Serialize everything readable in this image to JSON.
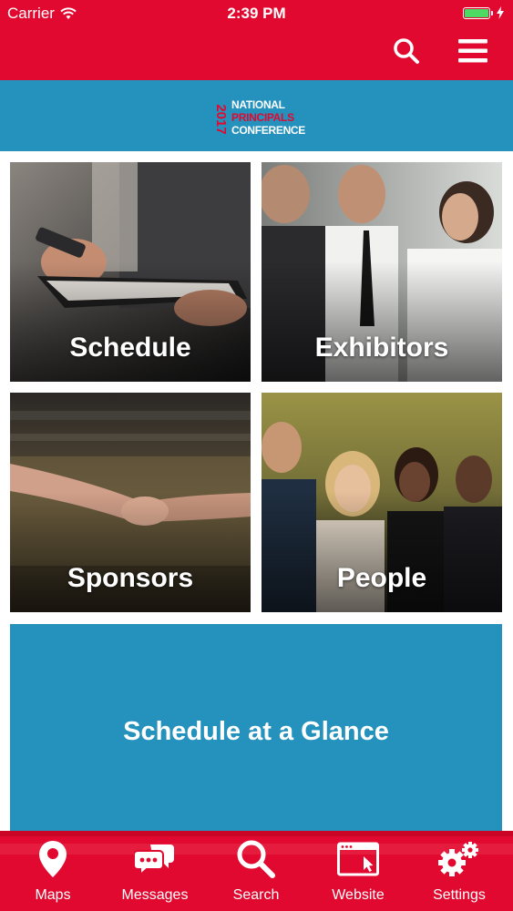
{
  "status_bar": {
    "carrier": "Carrier",
    "time": "2:39 PM"
  },
  "nav": {
    "search_icon": "search-icon",
    "menu_icon": "menu-icon"
  },
  "logo": {
    "year": "2017",
    "line1": "NATIONAL",
    "line2": "PRINCIPALS",
    "line3": "CONFERENCE"
  },
  "tiles": [
    {
      "label": "Schedule"
    },
    {
      "label": "Exhibitors"
    },
    {
      "label": "Sponsors"
    },
    {
      "label": "People"
    }
  ],
  "glance": {
    "label": "Schedule at a Glance"
  },
  "tabs": [
    {
      "label": "Maps",
      "icon": "map-pin-icon"
    },
    {
      "label": "Messages",
      "icon": "messages-icon"
    },
    {
      "label": "Search",
      "icon": "search-icon"
    },
    {
      "label": "Website",
      "icon": "website-icon"
    },
    {
      "label": "Settings",
      "icon": "gears-icon"
    }
  ],
  "colors": {
    "brand_red": "#e1092f",
    "brand_blue": "#2492bd",
    "battery_green": "#4cd964"
  }
}
